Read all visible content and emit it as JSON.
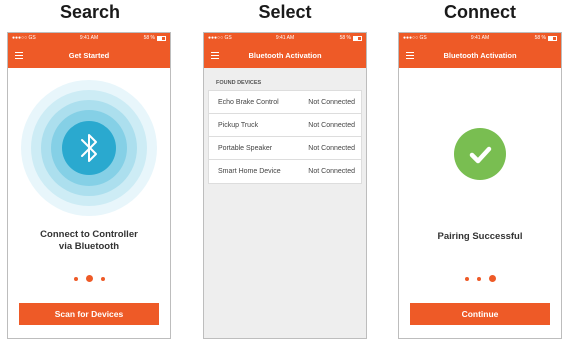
{
  "step_titles": [
    "Search",
    "Select",
    "Connect"
  ],
  "status_bar": {
    "carrier": "●●●○○ GS ",
    "time": "9:41 AM",
    "battery": "58 %"
  },
  "screen1": {
    "nav_title": "Get Started",
    "message_line1": "Connect to Controller",
    "message_line2": "via Bluetooth",
    "button_label": "Scan for Devices",
    "active_dot": 2
  },
  "screen2": {
    "nav_title": "Bluetooth Activation",
    "section_label": "FOUND DEVICES",
    "devices": [
      {
        "name": "Echo Brake Control",
        "status": "Not Connected"
      },
      {
        "name": "Pickup Truck",
        "status": "Not Connected"
      },
      {
        "name": "Portable Speaker",
        "status": "Not Connected"
      },
      {
        "name": "Smart Home Device",
        "status": "Not Connected"
      }
    ]
  },
  "screen3": {
    "nav_title": "Bluetooth Activation",
    "message": "Pairing Successful",
    "button_label": "Continue",
    "active_dot": 3
  },
  "colors": {
    "accent": "#ee5a27",
    "bluetooth": "#2aa9cf",
    "success": "#79be51"
  }
}
